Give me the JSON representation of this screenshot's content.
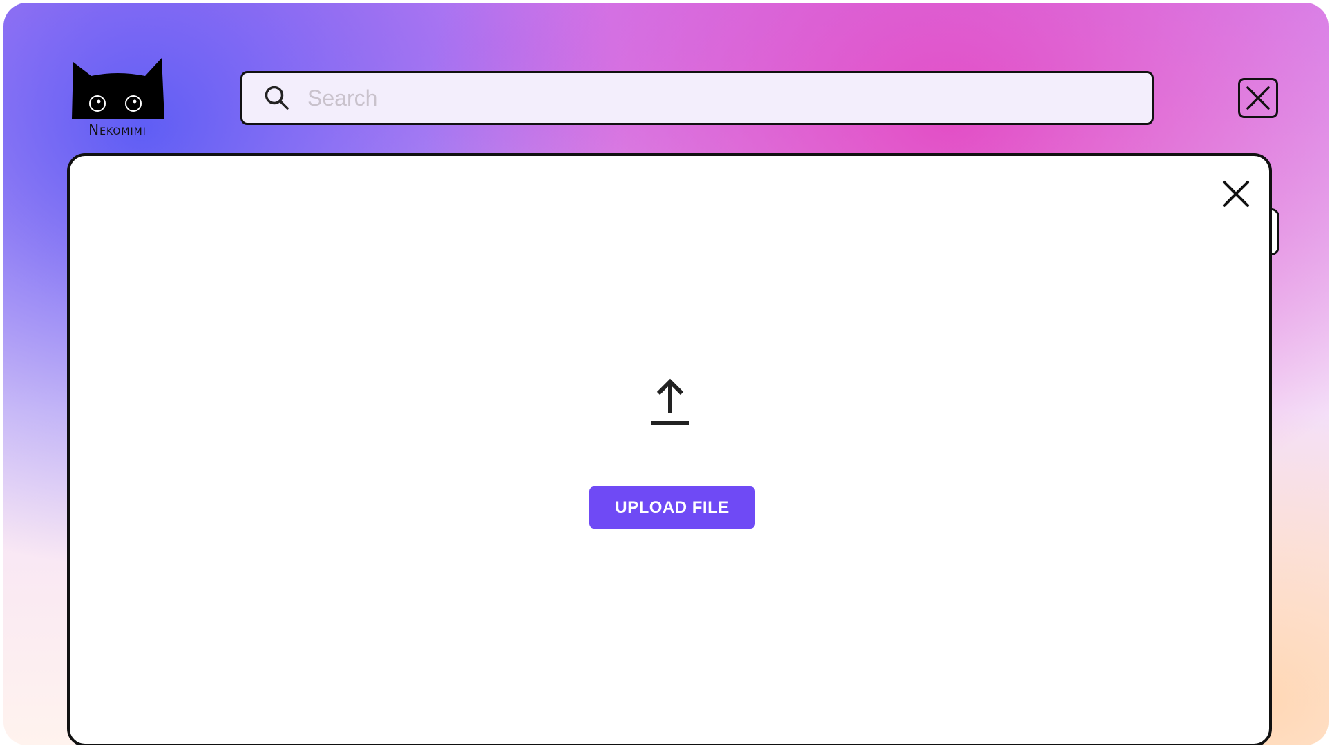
{
  "app": {
    "brand_name": "Nekomimi",
    "logo_icon": "cat-head-icon"
  },
  "header": {
    "search": {
      "placeholder": "Search",
      "value": "",
      "icon": "search-icon"
    },
    "close_icon": "close-square-icon"
  },
  "upload_modal": {
    "close_icon": "close-icon",
    "upload_icon": "upload-arrow-icon",
    "upload_button_label": "UPLOAD FILE"
  },
  "colors": {
    "accent": "#6f4af5",
    "search_background": "#f3eefc"
  }
}
